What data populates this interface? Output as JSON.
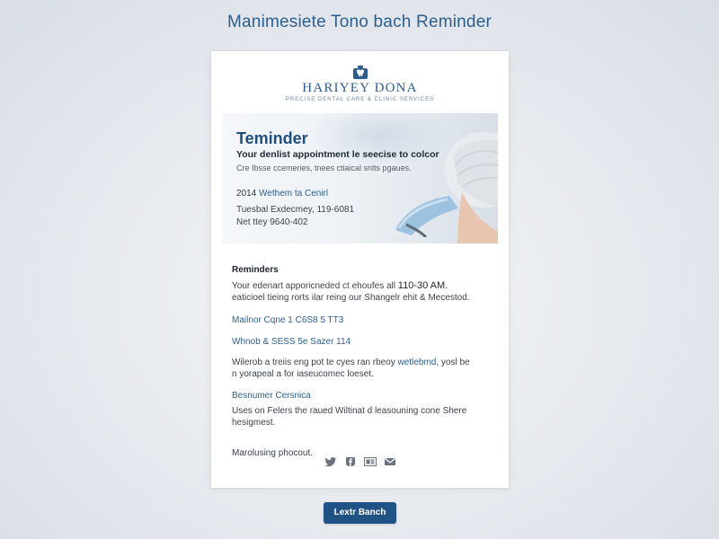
{
  "page": {
    "title": "Manimesiete Tono bach Reminder"
  },
  "logo": {
    "name": "HARIYEY DONA",
    "tagline": "PRECISE DENTAL CARE & CLINIC SERVICES"
  },
  "hero": {
    "title": "Teminder",
    "subtitle": "Your denlist appointment le seecise to colcor",
    "description": "Cre Ibsse ccemeries, tnees ctiaical snlts pgaues.",
    "clinic_number": "2014",
    "clinic_name": "Wethem ta Cenirl",
    "address": "Tuesbal Exdecmey, 119-6081",
    "phone": "Net ttey 9640-402"
  },
  "body": {
    "heading": "Reminders",
    "intro_line1_prefix": "Your edenart apporicneded ct ehoufes all",
    "intro_line1_time": "110-30 AM.",
    "intro_line2": "eaticioel tieing rorts ilar reing our Shangelr ehit & Mecestod.",
    "link1": "Mailnor Cqne 1 C6S8 5 TT3",
    "link2": "Whnob & SESS 5e Sazer 114",
    "para1_prefix": "Wilerob a treiis eng pot te cyes ran rbeoy",
    "para1_link": "wetlebmd,",
    "para1_suffix": "yosl be",
    "para1_line2": "n yorapeal a for iaseucomec loeset.",
    "link3": "Besnumer Cersnica",
    "para2_line1": "Uses on Felers the raued Wiltinat d leasouning cone Shere",
    "para2_line2": "hesigmest.",
    "signoff": "Marolusing phocout."
  },
  "social": {
    "icons": [
      "twitter-icon",
      "facebook-icon",
      "tw-badge-icon",
      "mail-icon"
    ]
  },
  "cta": {
    "label": "Lextr Banch"
  },
  "colors": {
    "brand": "#2c5d8e",
    "button": "#1f5385",
    "link": "#2b5f8f"
  }
}
